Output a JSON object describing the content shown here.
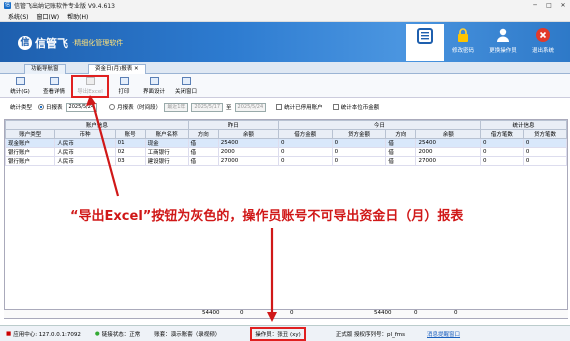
{
  "window": {
    "title": "信管飞出纳记账软件专业版 V9.4.613"
  },
  "menu": [
    "系统(S)",
    "窗口(W)",
    "帮助(H)"
  ],
  "banner": {
    "logo_mark": "信",
    "brand": "信管飞",
    "slogan": "·精细化管理软件"
  },
  "top_buttons": [
    {
      "label": "",
      "icon": "report-icon"
    },
    {
      "label": "修改密码",
      "icon": "lock-icon"
    },
    {
      "label": "更换操作员",
      "icon": "user-switch-icon"
    },
    {
      "label": "退出系统",
      "icon": "power-icon"
    }
  ],
  "tabs": [
    "功能导航窗",
    "资金日(月)报表"
  ],
  "toolbar": [
    {
      "label": "统计(G)",
      "enabled": true
    },
    {
      "label": "查看详情",
      "enabled": true
    },
    {
      "label": "导出Excel",
      "enabled": false
    },
    {
      "label": "打印",
      "enabled": true
    },
    {
      "label": "界面设计",
      "enabled": true
    },
    {
      "label": "关闭窗口",
      "enabled": true
    }
  ],
  "filter": {
    "type_label": "统计类型",
    "daily_label": "日报表",
    "daily_date": "2025/5/24",
    "monthly_label": "月报表（时间段）",
    "monthly_mode": "最近1年",
    "from_date": "2025/5/17",
    "to_label": "至",
    "to_date": "2025/5/24",
    "opt1": "统计已停用账户",
    "opt2": "统计本位币金额"
  },
  "grid": {
    "group_headers": [
      "账户信息",
      "昨日",
      "今日",
      "统计信息"
    ],
    "columns": [
      "账户类型",
      "币种",
      "账号",
      "账户名称",
      "方向",
      "余额",
      "借方金额",
      "贷方金额",
      "方向",
      "余额",
      "借方笔数",
      "贷方笔数"
    ],
    "rows": [
      [
        "现金账户",
        "人民币",
        "01",
        "现金",
        "借",
        "25400",
        "0",
        "0",
        "借",
        "25400",
        "0",
        "0"
      ],
      [
        "银行账户",
        "人民币",
        "02",
        "工商银行",
        "借",
        "2000",
        "0",
        "0",
        "借",
        "2000",
        "0",
        "0"
      ],
      [
        "银行账户",
        "人民币",
        "03",
        "建设银行",
        "借",
        "27000",
        "0",
        "0",
        "借",
        "27000",
        "0",
        "0"
      ]
    ],
    "totals": [
      "54400",
      "0",
      "0",
      "54400",
      "0",
      "0"
    ]
  },
  "annotation": "“导出Excel”按钮为灰色的，操作员账号不可导出资金日（月）报表",
  "status": {
    "server": "应用中心: 127.0.0.1:7092",
    "conn": "链接状态：正常",
    "ledger": "账套：演示账套（录视频）",
    "operator": "操作员：张丑 (xy)",
    "edition": "正式版 授权序列号：pl_fms",
    "notice": "消息提醒窗口"
  }
}
